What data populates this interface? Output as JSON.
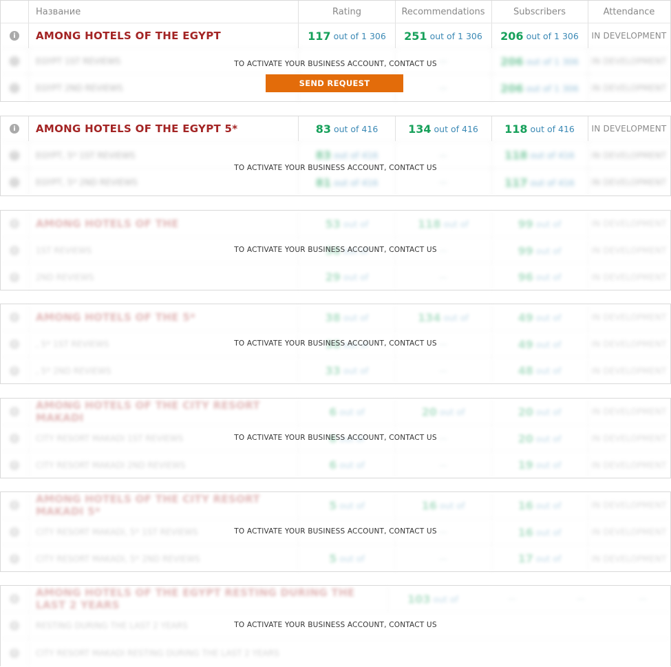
{
  "header": {
    "name": "Название",
    "rating": "Rating",
    "recommendations": "Recommendations",
    "subscribers": "Subscribers",
    "attendance": "Attendance"
  },
  "overlay_text": "TO ACTIVATE YOUR BUSINESS ACCOUNT, CONTACT US",
  "send_request": "SEND REQUEST",
  "icon": "i",
  "groups": [
    {
      "title": "AMONG HOTELS OF THE EGYPT",
      "rating": "117",
      "rating_of": "out of 1 306",
      "recommendations": "251",
      "recommendations_of": "out of 1 306",
      "subscribers": "206",
      "subscribers_of": "out of 1 306",
      "attendance": "IN DEVELOPMENT",
      "rows": [
        "EGYPT 1ST REVIEWS",
        "EGYPT 2ND REVIEWS"
      ]
    },
    {
      "title": "AMONG HOTELS OF THE EGYPT 5*",
      "rating": "83",
      "rating_of": "out of 416",
      "recommendations": "134",
      "recommendations_of": "out of 416",
      "subscribers": "118",
      "subscribers_of": "out of 416",
      "attendance": "IN DEVELOPMENT",
      "rows": [
        "EGYPT, 5* 1ST REVIEWS",
        "EGYPT, 5* 2ND REVIEWS"
      ]
    },
    {
      "title": "AMONG HOTELS OF THE",
      "rows": [
        "1ST REVIEWS",
        "2ND REVIEWS"
      ]
    },
    {
      "title": "AMONG HOTELS OF THE 5*",
      "rows": ", 5* 1ST REVIEWS|, 5* 2ND REVIEWS"
    },
    {
      "title": "AMONG HOTELS OF THE CITY RESORT MAKADI",
      "rows": [
        "CITY RESORT MAKADI 1ST REVIEWS",
        "CITY RESORT MAKADI 2ND REVIEWS"
      ]
    },
    {
      "title": "AMONG HOTELS OF THE CITY RESORT MAKADI 5*",
      "rows": [
        "CITY RESORT MAKADI, 5* 1ST REVIEWS",
        "CITY RESORT MAKADI, 5* 2ND REVIEWS"
      ]
    },
    {
      "title": "AMONG HOTELS OF THE EGYPT RESTING DURING THE LAST 2 YEARS",
      "rows": [
        "RESTING DURING THE LAST 2 YEARS",
        "CITY RESORT MAKADI RESTING DURING THE LAST 2 YEARS"
      ]
    }
  ],
  "blurred": {
    "g3": {
      "r": "53",
      "rec": "118",
      "sub": "99",
      "r1": "56",
      "r2": "29",
      "s1": "99",
      "s2": "96"
    },
    "g4": {
      "r": "38",
      "rec": "134",
      "sub": "49",
      "r1": "38",
      "r2": "33",
      "s1": "49",
      "s2": "48"
    },
    "g5": {
      "r": "6",
      "rec": "20",
      "sub": "20",
      "r1": "6",
      "r2": "6",
      "s1": "20",
      "s2": "19"
    },
    "g6": {
      "r": "5",
      "rec": "16",
      "sub": "16",
      "r1": "5",
      "r2": "5",
      "s1": "16",
      "s2": "17"
    },
    "g7": {
      "r": "103"
    },
    "g1": {
      "s1": "206",
      "s2": "206"
    },
    "g2": {
      "r1": "83",
      "r2": "81",
      "s1": "118",
      "s2": "117"
    },
    "of_text": "out of",
    "dev": "IN DEVELOPMENT",
    "dash": "—"
  }
}
